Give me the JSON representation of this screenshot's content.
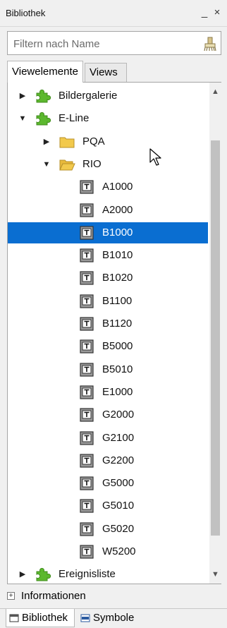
{
  "window": {
    "title": "Bibliothek",
    "minimize_label": "_",
    "close_label": "×"
  },
  "filter": {
    "placeholder": "Filtern nach Name",
    "value": ""
  },
  "tabs": [
    {
      "label": "Viewelemente",
      "active": true
    },
    {
      "label": "Views",
      "active": false
    }
  ],
  "tree": {
    "rows": [
      {
        "label": "Bildergalerie",
        "level": 0,
        "icon": "puzzle-icon",
        "expand": "collapsed"
      },
      {
        "label": "E-Line",
        "level": 0,
        "icon": "puzzle-icon",
        "expand": "expanded"
      },
      {
        "label": "PQA",
        "level": 1,
        "icon": "folder-icon",
        "expand": "collapsed"
      },
      {
        "label": "RIO",
        "level": 1,
        "icon": "folder-open-icon",
        "expand": "expanded"
      },
      {
        "label": "A1000",
        "level": 2,
        "icon": "text-element-icon",
        "expand": "none"
      },
      {
        "label": "A2000",
        "level": 2,
        "icon": "text-element-icon",
        "expand": "none"
      },
      {
        "label": "B1000",
        "level": 2,
        "icon": "text-element-icon",
        "expand": "none",
        "selected": true
      },
      {
        "label": "B1010",
        "level": 2,
        "icon": "text-element-icon",
        "expand": "none"
      },
      {
        "label": "B1020",
        "level": 2,
        "icon": "text-element-icon",
        "expand": "none"
      },
      {
        "label": "B1100",
        "level": 2,
        "icon": "text-element-icon",
        "expand": "none"
      },
      {
        "label": "B1120",
        "level": 2,
        "icon": "text-element-icon",
        "expand": "none"
      },
      {
        "label": "B5000",
        "level": 2,
        "icon": "text-element-icon",
        "expand": "none"
      },
      {
        "label": "B5010",
        "level": 2,
        "icon": "text-element-icon",
        "expand": "none"
      },
      {
        "label": "E1000",
        "level": 2,
        "icon": "text-element-icon",
        "expand": "none"
      },
      {
        "label": "G2000",
        "level": 2,
        "icon": "text-element-icon",
        "expand": "none"
      },
      {
        "label": "G2100",
        "level": 2,
        "icon": "text-element-icon",
        "expand": "none"
      },
      {
        "label": "G2200",
        "level": 2,
        "icon": "text-element-icon",
        "expand": "none"
      },
      {
        "label": "G5000",
        "level": 2,
        "icon": "text-element-icon",
        "expand": "none"
      },
      {
        "label": "G5010",
        "level": 2,
        "icon": "text-element-icon",
        "expand": "none"
      },
      {
        "label": "G5020",
        "level": 2,
        "icon": "text-element-icon",
        "expand": "none"
      },
      {
        "label": "W5200",
        "level": 2,
        "icon": "text-element-icon",
        "expand": "none"
      },
      {
        "label": "Ereignisliste",
        "level": 0,
        "icon": "puzzle-icon",
        "expand": "collapsed"
      }
    ]
  },
  "informationen": {
    "label": "Informationen",
    "expand_glyph": "+"
  },
  "bottom_tabs": [
    {
      "label": "Bibliothek",
      "icon": "library-icon",
      "active": true
    },
    {
      "label": "Symbole",
      "icon": "symbols-icon",
      "active": false
    }
  ],
  "colors": {
    "selection": "#0a6ed1",
    "puzzle": "#5cb82e",
    "folder": "#f2c94c"
  }
}
